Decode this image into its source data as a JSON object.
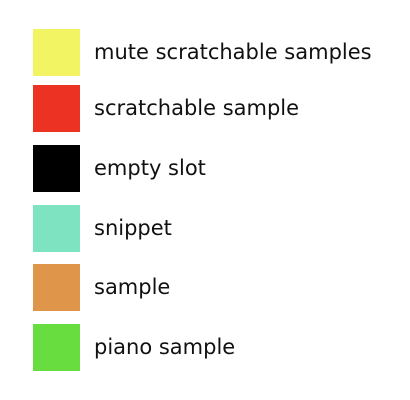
{
  "legend": {
    "items": [
      {
        "label": "mute scratchable samples",
        "color": "#f2f464"
      },
      {
        "label": "scratchable sample",
        "color": "#ec3323"
      },
      {
        "label": "empty slot",
        "color": "#000000"
      },
      {
        "label": "snippet",
        "color": "#7ee3c1"
      },
      {
        "label": "sample",
        "color": "#e0964a"
      },
      {
        "label": "piano sample",
        "color": "#67dd40"
      }
    ]
  }
}
